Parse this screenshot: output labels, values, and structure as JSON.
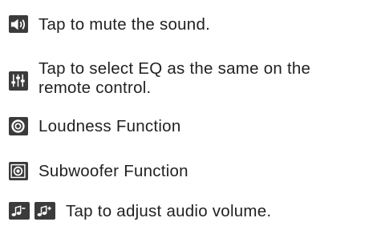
{
  "items": [
    {
      "icon": "speaker-mute-icon",
      "text": "Tap to mute the sound."
    },
    {
      "icon": "equalizer-icon",
      "line1": "Tap to select EQ as the same on the",
      "line2": "remote control."
    },
    {
      "icon": "loudness-icon",
      "text": "Loudness Function"
    },
    {
      "icon": "subwoofer-icon",
      "text": "Subwoofer Function"
    },
    {
      "icon": "volume-down-icon",
      "icon2": "volume-up-icon",
      "text": "Tap to adjust audio volume."
    }
  ]
}
